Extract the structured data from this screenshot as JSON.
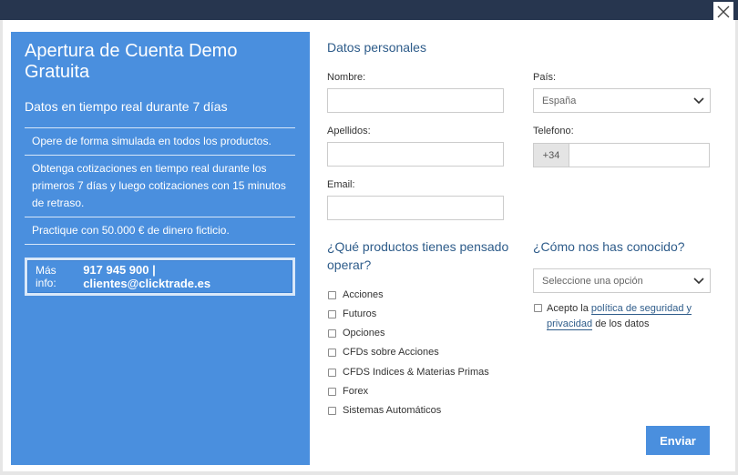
{
  "left": {
    "title": "Apertura de Cuenta Demo Gratuita",
    "subtitle": "Datos en tiempo real durante 7 días",
    "features": [
      "Opere de forma simulada en todos los productos.",
      "Obtenga cotizaciones en tiempo real durante los primeros 7 días y luego cotizaciones con 15 minutos de retraso.",
      "Practique con 50.000 € de dinero ficticio."
    ],
    "info_prefix": "Más info:",
    "info_contact": "917 945 900 | clientes@clicktrade.es"
  },
  "form": {
    "section_title": "Datos personales",
    "nombre_label": "Nombre:",
    "nombre_value": "",
    "apellidos_label": "Apellidos:",
    "apellidos_value": "",
    "email_label": "Email:",
    "email_value": "",
    "pais_label": "País:",
    "pais_value": "España",
    "telefono_label": "Telefono:",
    "telefono_prefix": "+34",
    "telefono_value": "",
    "productos_question": "¿Qué productos tienes pensado operar?",
    "productos": [
      "Acciones",
      "Futuros",
      "Opciones",
      "CFDs sobre Acciones",
      "CFDS Indices & Materias Primas",
      "Forex",
      "Sistemas Automáticos"
    ],
    "conocido_question": "¿Cómo nos has conocido?",
    "conocido_placeholder": "Seleccione una opción",
    "privacy_prefix": "Acepto la ",
    "privacy_link1": "política de seguridad y",
    "privacy_link2": "privacidad",
    "privacy_suffix": " de los datos",
    "submit_label": "Enviar"
  },
  "colors": {
    "accent": "#4a8fde",
    "topbar": "#27364f",
    "heading": "#2e5c8a"
  }
}
